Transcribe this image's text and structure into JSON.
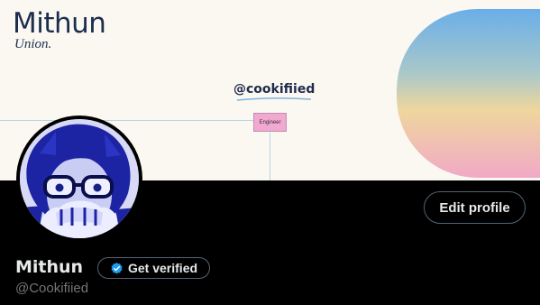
{
  "banner": {
    "brand_name": "Mithun",
    "brand_sub": "Union.",
    "handle": "@cookifiied",
    "role_label": "Engineer"
  },
  "profile": {
    "display_name": "Mithun",
    "username": "@Cookifiied",
    "edit_profile_label": "Edit profile",
    "get_verified_label": "Get verified",
    "verified_badge_icon": "verified-badge-icon"
  },
  "colors": {
    "background": "#000000",
    "text_primary": "#e7e9ea",
    "text_secondary": "#71767b",
    "border": "#536471",
    "verified_blue": "#1d9bf0"
  }
}
